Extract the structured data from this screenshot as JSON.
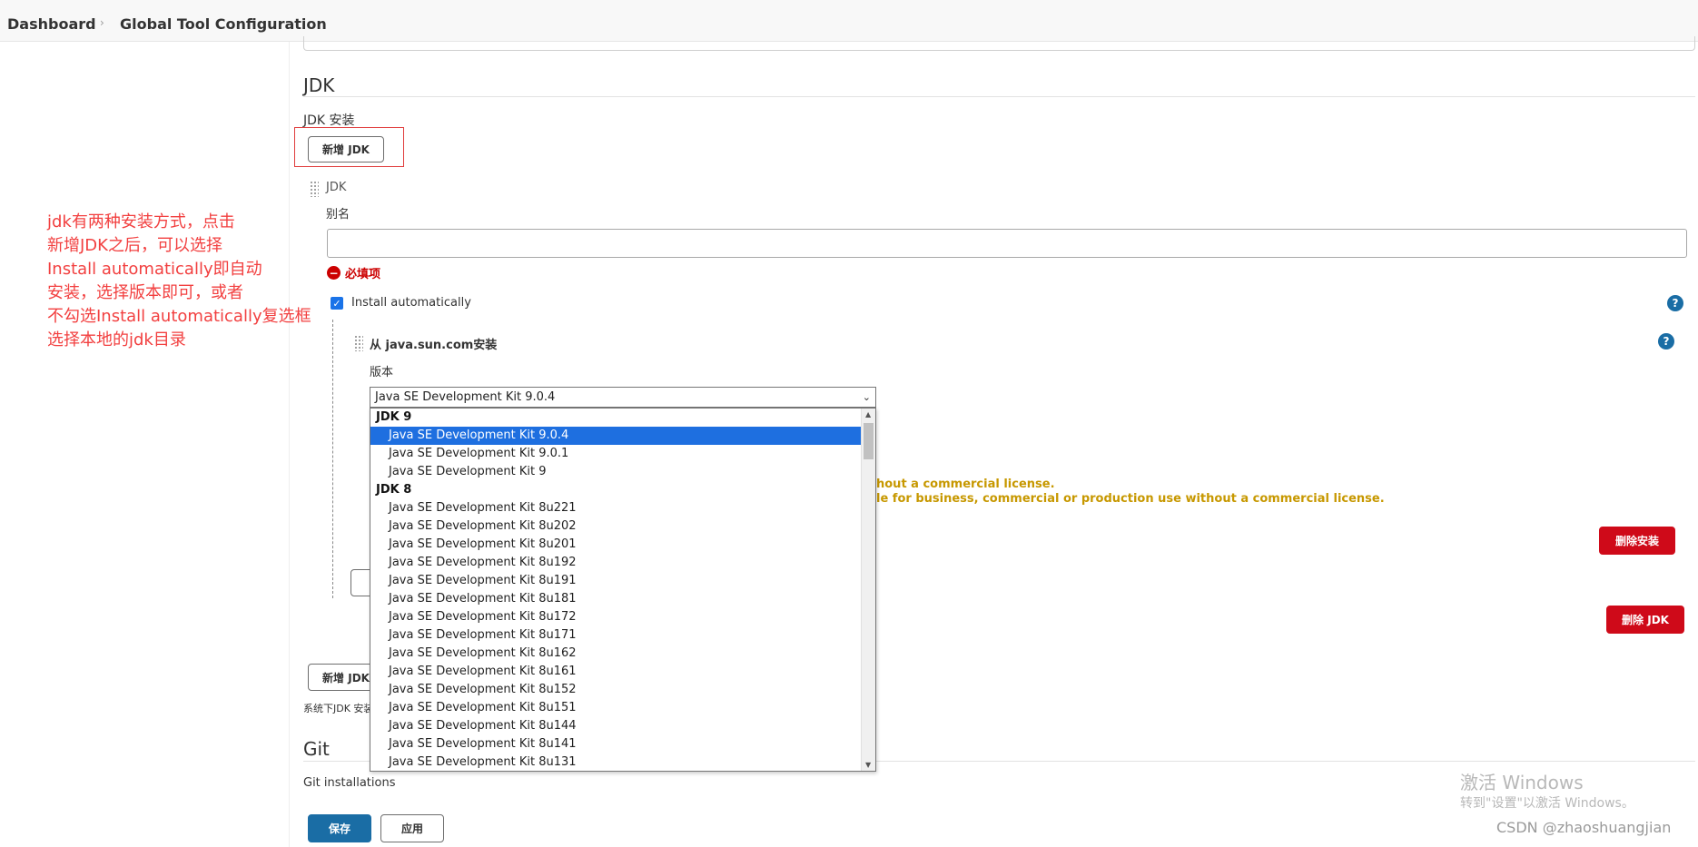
{
  "breadcrumb": {
    "items": [
      "Dashboard",
      "Global Tool Configuration"
    ],
    "separator": "›"
  },
  "jdk": {
    "section_title": "JDK",
    "installations_label": "JDK 安装",
    "add_jdk_label": "新增 JDK",
    "item_title": "JDK",
    "alias_label": "别名",
    "alias_value": "",
    "required_label": "必填项",
    "install_auto_label": "Install automatically",
    "install_auto_checked": true,
    "installer_title": "从 java.sun.com安装",
    "version_label": "版本",
    "version_selected": "Java SE Development Kit 9.0.4",
    "warning_lines": [
      "hout a commercial license.",
      "le for business, commercial or production use without a commercial license."
    ],
    "delete_installer_label": "删除安装",
    "delete_jdk_label": "删除 JDK",
    "add_jdk_bottom_label": "新增 JDK",
    "system_note": "系统下JDK 安装"
  },
  "dropdown": {
    "groups": [
      {
        "label": "JDK 9",
        "options": [
          "Java SE Development Kit 9.0.4",
          "Java SE Development Kit 9.0.1",
          "Java SE Development Kit 9"
        ]
      },
      {
        "label": "JDK 8",
        "options": [
          "Java SE Development Kit 8u221",
          "Java SE Development Kit 8u202",
          "Java SE Development Kit 8u201",
          "Java SE Development Kit 8u192",
          "Java SE Development Kit 8u191",
          "Java SE Development Kit 8u181",
          "Java SE Development Kit 8u172",
          "Java SE Development Kit 8u171",
          "Java SE Development Kit 8u162",
          "Java SE Development Kit 8u161",
          "Java SE Development Kit 8u152",
          "Java SE Development Kit 8u151",
          "Java SE Development Kit 8u144",
          "Java SE Development Kit 8u141",
          "Java SE Development Kit 8u131"
        ]
      }
    ],
    "selected": "Java SE Development Kit 9.0.4"
  },
  "git": {
    "section_title": "Git",
    "installations_label": "Git installations"
  },
  "footer": {
    "save_label": "保存",
    "apply_label": "应用"
  },
  "annotation": {
    "lines": [
      "jdk有两种安装方式，点击",
      "新增JDK之后，可以选择",
      "Install automatically即自动",
      "安装，选择版本即可，或者",
      "不勾选Install automatically复选框",
      "选择本地的jdk目录"
    ]
  },
  "watermark": {
    "title": "激活 Windows",
    "subtitle": "转到\"设置\"以激活 Windows。",
    "csdn": "CSDN @zhaoshuangjian"
  },
  "colors": {
    "primary": "#1a6da5",
    "danger": "#cf0a19",
    "warning": "#c79800",
    "annotation": "#f24040",
    "selected_option": "#1e6fe0"
  }
}
